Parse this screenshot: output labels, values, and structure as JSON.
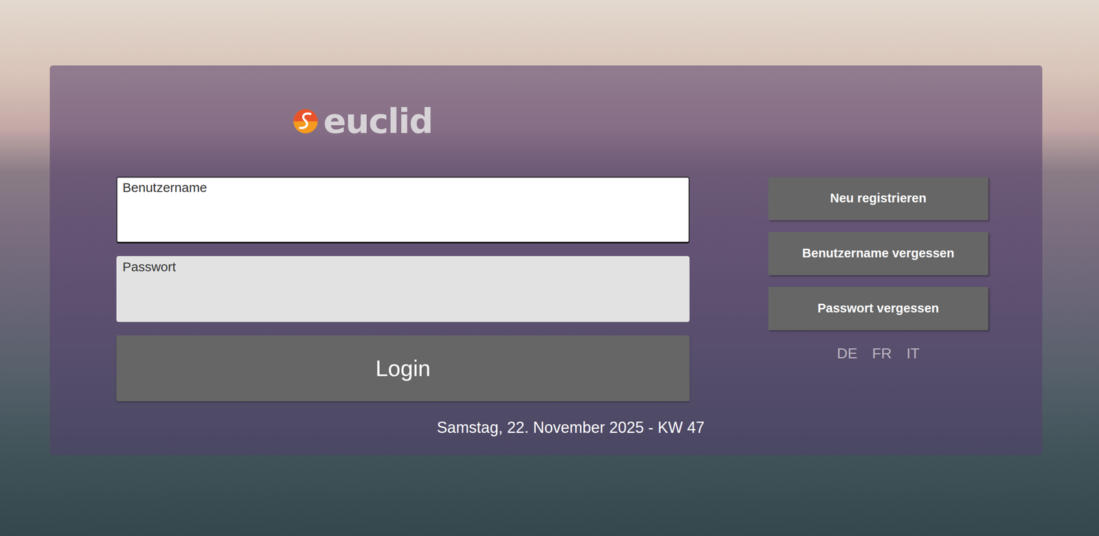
{
  "logo": {
    "text": "euclid"
  },
  "fields": [
    {
      "label": "Benutzername",
      "focused": true
    },
    {
      "label": "Passwort",
      "focused": false
    }
  ],
  "login_button": "Login",
  "side_buttons": [
    "Neu registrieren",
    "Benutzername vergessen",
    "Passwort vergessen"
  ],
  "languages": [
    {
      "label": "DE"
    },
    {
      "label": "FR"
    },
    {
      "label": "IT"
    }
  ],
  "date": "Samstag, 22. November 2025 - KW 47"
}
